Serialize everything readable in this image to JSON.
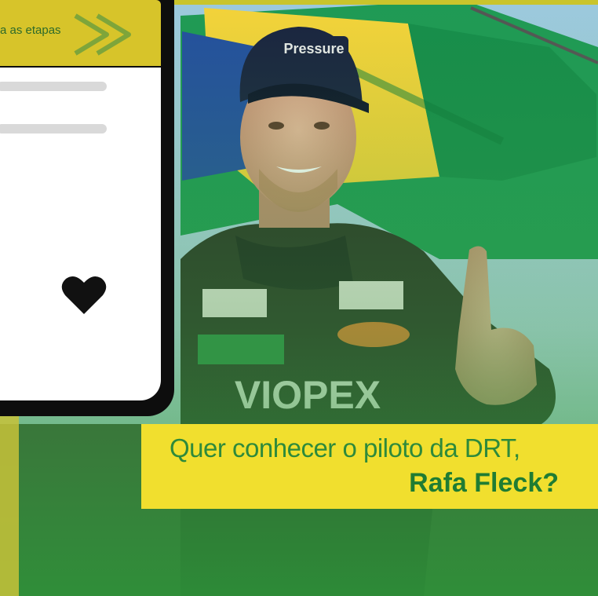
{
  "post_card": {
    "header_text": "a as etapas",
    "icons": [
      "chevron-right-icon",
      "heart-icon"
    ]
  },
  "caption": {
    "line1": "Quer conhecer o piloto da DRT,",
    "line2": "Rafa Fleck?"
  },
  "photo": {
    "cap_logo": "Pressure",
    "suit_logo": "VIOPEX"
  },
  "colors": {
    "brand_yellow": "#f1df2e",
    "header_yellow": "#d7c42a",
    "brand_green": "#1f7c33",
    "phone_frame": "#0d0d0d"
  }
}
